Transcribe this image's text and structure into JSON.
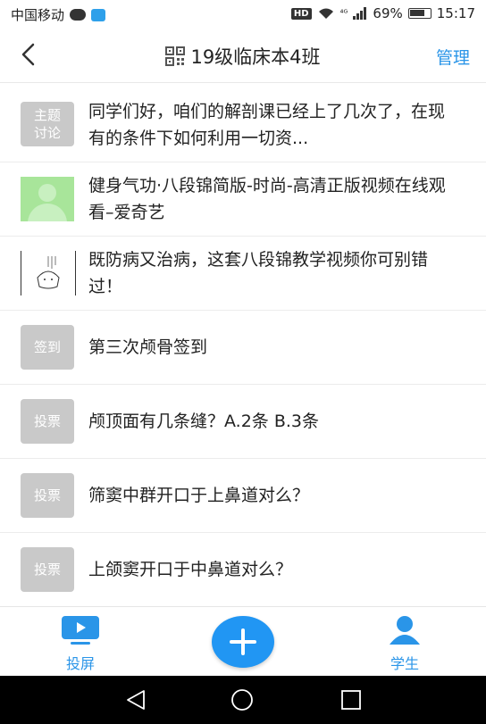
{
  "status": {
    "carrier": "中国移动",
    "hd": "HD",
    "network": "⁴ᴳ",
    "battery": "69%",
    "time": "15:17"
  },
  "header": {
    "title": "19级临床本4班",
    "manage": "管理"
  },
  "items": [
    {
      "tag": "主题\n讨论",
      "text": "同学们好，咱们的解剖课已经上了几次了，在现有的条件下如何利用一切资..."
    },
    {
      "tag": "",
      "text": "健身气功·八段锦简版-时尚-高清正版视频在线观看–爱奇艺"
    },
    {
      "tag": "",
      "text": "既防病又治病，这套八段锦教学视频你可别错过！"
    },
    {
      "tag": "签到",
      "text": "第三次颅骨签到"
    },
    {
      "tag": "投票",
      "text": "颅顶面有几条缝？A.2条  B.3条"
    },
    {
      "tag": "投票",
      "text": "筛窦中群开口于上鼻道对么？"
    },
    {
      "tag": "投票",
      "text": "上颌窦开口于中鼻道对么？"
    }
  ],
  "tabbar": {
    "cast_label": "投屏",
    "student_label": "学生"
  },
  "colors": {
    "accent": "#2a95e8",
    "tag_gray": "#c9c9c9",
    "fab": "#2196f3"
  }
}
